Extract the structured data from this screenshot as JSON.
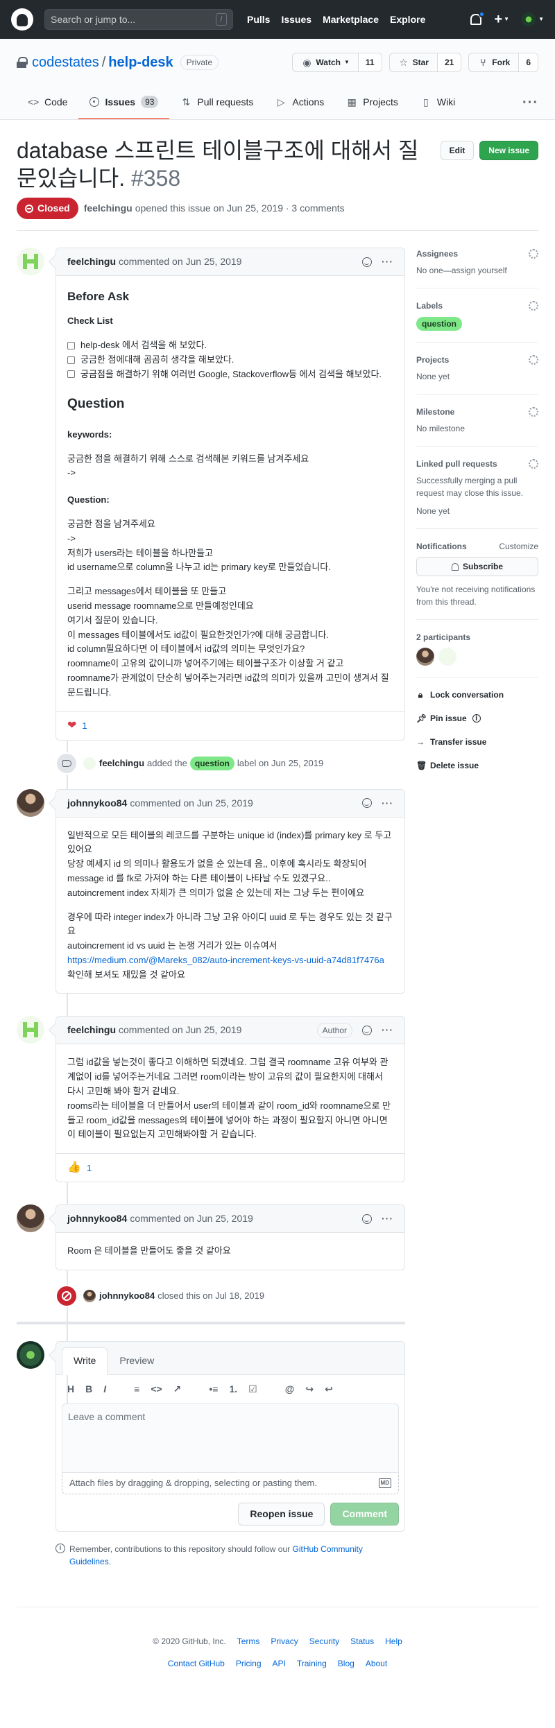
{
  "header": {
    "search_placeholder": "Search or jump to...",
    "slash": "/",
    "nav": [
      "Pulls",
      "Issues",
      "Marketplace",
      "Explore"
    ]
  },
  "repo": {
    "owner": "codestates",
    "name": "help-desk",
    "visibility": "Private",
    "watch_label": "Watch",
    "watch_count": "11",
    "star_label": "Star",
    "star_count": "21",
    "fork_label": "Fork",
    "fork_count": "6",
    "tabs": [
      {
        "label": "Code",
        "icon": "code-icon"
      },
      {
        "label": "Issues",
        "count": "93",
        "icon": "issue-icon"
      },
      {
        "label": "Pull requests",
        "icon": "pull-request-icon"
      },
      {
        "label": "Actions",
        "icon": "play-icon"
      },
      {
        "label": "Projects",
        "icon": "project-icon"
      },
      {
        "label": "Wiki",
        "icon": "book-icon"
      }
    ]
  },
  "issue": {
    "title": "database 스프린트 테이블구조에 대해서 질문있습니다.",
    "number": "#358",
    "edit_label": "Edit",
    "new_issue_label": "New issue",
    "state": "Closed",
    "author": "feelchingu",
    "meta": "opened this issue on Jun 25, 2019 · 3 comments"
  },
  "first_comment": {
    "author": "feelchingu",
    "date": "commented on Jun 25, 2019",
    "before_ask": "Before Ask",
    "check_list": "Check List",
    "checks": [
      "help-desk 에서 검색을 해 보았다.",
      "궁금한 점에대해 곰곰히 생각을 해보았다.",
      "궁금점을 해결하기 위해 여러번 Google, Stackoverflow등 에서 검색을 해보았다."
    ],
    "question_heading": "Question",
    "keywords_heading": "keywords:",
    "keywords_text": "궁금한 점을 해결하기 위해 스스로 검색해본 키워드를 남겨주세요",
    "keywords_arrow": "->",
    "question_label": "Question:",
    "q_lines": [
      "궁금한 점을 남겨주세요",
      "->",
      "저희가 users라는 테이블을 하나만들고",
      "id username으로 column을 나누고 id는 primary key로 만들었습니다."
    ],
    "q_lines2": [
      "그리고 messages에서 테이블을 또 만들고",
      "userid message roomname으로 만들예정인데요",
      "여기서 질문이 있습니다.",
      "이 messages 테이블에서도 id값이 필요한것인가?에 대해 궁금합니다.",
      "id column필요하다면 이 테이블에서 id값의 의미는 무엇인가요?",
      "roomname이 고유의 값이니까 넣어주기에는 테이블구조가 이상할 거 같고",
      "roomname가 관계없이 단순히 넣어주는거라면 id값의 의미가 있을까 고민이 생겨서 질문드립니다."
    ],
    "reaction_count": "1"
  },
  "label_event": {
    "actor": "feelchingu",
    "prefix": "added the",
    "label": "question",
    "suffix": "label on Jun 25, 2019"
  },
  "comment2": {
    "author": "johnnykoo84",
    "date": "commented on Jun 25, 2019",
    "p1": [
      "일반적으로 모든 테이블의 레코드를 구분하는 unique id (index)를 primary key 로 두고 있어요",
      "당장 예세지 id 의 의미나 활용도가 없을 순 있는데 음,, 이후에 혹시라도 확장되어 message id 를 fk로 가져야 하는 다른 테이블이 나타날 수도 있겠구요..",
      "autoincrement index 자체가 큰 의미가 없을 순 있는데 저는 그냥 두는 편이에요"
    ],
    "p2": [
      "경우에 따라 integer index가 아니라 그냥 고유 아이디 uuid 로 두는 경우도 있는 것 같구요",
      "autoincrement id vs uuid 는 논쟁 거리가 있는 이슈여서"
    ],
    "link": "https://medium.com/@Mareks_082/auto-increment-keys-vs-uuid-a74d81f7476a",
    "link_suffix": " 확인해 보셔도 재밌을 것 같아요"
  },
  "comment3": {
    "author": "feelchingu",
    "date": "commented on Jun 25, 2019",
    "badge": "Author",
    "p1": [
      "그럼 id값을 넣는것이 좋다고 이해하면 되겠네요. 그럼 결국 roomname 고유 여부와 관계없이 id를 넣어주는거네요 그러면 room이라는 방이 고유의 값이 필요한지에 대해서 다시 고민해 봐야 할거 같네요.",
      "rooms라는 테이블을 더 만들어서 user의 테이블과 같이 room_id와 roomname으로 만들고 room_id값을 messages의 테이블에 넣어야 하는 과정이 필요할지 아니면 아니면 이 테이블이 필요없는지 고민해봐야할 거 같습니다."
    ],
    "reaction_count": "1"
  },
  "comment4": {
    "author": "johnnykoo84",
    "date": "commented on Jun 25, 2019",
    "body": "Room 은 테이블을 만들어도 좋을 것 같아요"
  },
  "close_event": {
    "actor": "johnnykoo84",
    "text": "closed this on Jul 18, 2019"
  },
  "composer": {
    "tab_write": "Write",
    "tab_preview": "Preview",
    "toolbar": [
      "H",
      "B",
      "I",
      "≡",
      "<>",
      "↗",
      "•≡",
      "1.",
      "☑",
      "@",
      "↪",
      "↩"
    ],
    "placeholder": "Leave a comment",
    "drop_hint": "Attach files by dragging & dropping, selecting or pasting them.",
    "md_badge": "MD",
    "reopen_label": "Reopen issue",
    "comment_label": "Comment",
    "guidelines_prefix": "Remember, contributions to this repository should follow our",
    "guidelines_link": "GitHub Community Guidelines",
    "guidelines_suffix": "."
  },
  "sidebar": {
    "assignees_title": "Assignees",
    "assignees_value": "No one—assign yourself",
    "labels_title": "Labels",
    "labels_value": "question",
    "projects_title": "Projects",
    "projects_value": "None yet",
    "milestone_title": "Milestone",
    "milestone_value": "No milestone",
    "linked_title": "Linked pull requests",
    "linked_desc": "Successfully merging a pull request may close this issue.",
    "linked_value": "None yet",
    "notifications_title": "Notifications",
    "customize": "Customize",
    "subscribe": "Subscribe",
    "notif_desc": "You're not receiving notifications from this thread.",
    "participants_title": "2 participants",
    "lock": "Lock conversation",
    "pin": "Pin issue",
    "transfer": "Transfer issue",
    "delete": "Delete issue"
  },
  "footer": {
    "copyright": "© 2020 GitHub, Inc.",
    "row1": [
      "Terms",
      "Privacy",
      "Security",
      "Status",
      "Help"
    ],
    "row2": [
      "Contact GitHub",
      "Pricing",
      "API",
      "Training",
      "Blog",
      "About"
    ]
  }
}
